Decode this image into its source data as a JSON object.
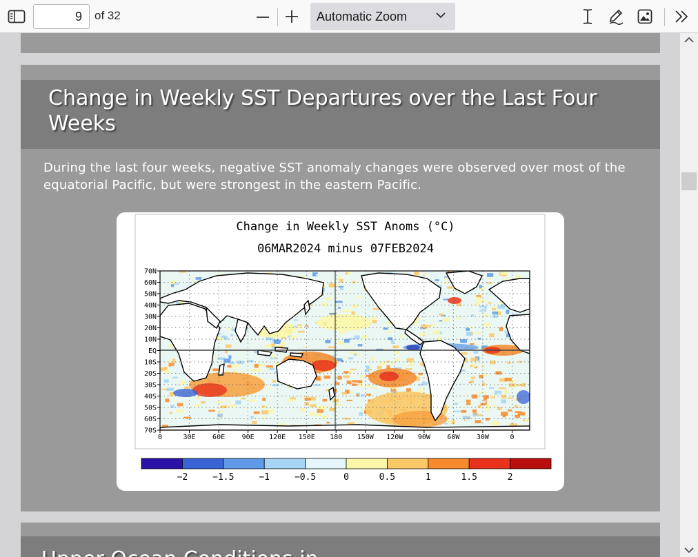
{
  "toolbar": {
    "page_number": "9",
    "page_count": "of 32",
    "zoom_value": "Automatic Zoom",
    "icons": {
      "sidebar": "sidebar-toggle-icon",
      "zoom_out": "minus-icon",
      "zoom_in": "plus-icon",
      "dropdown": "chevron-down-icon",
      "text": "text-cursor-icon",
      "draw": "pencil-icon",
      "image": "image-icon",
      "more": "double-chevron-right-icon"
    }
  },
  "slide": {
    "title": "Change in Weekly SST Departures over the Last Four Weeks",
    "description": "During the last four weeks, negative SST anomaly changes were observed over most of the equatorial Pacific, but were strongest in the eastern Pacific.",
    "next_title": "Upper Ocean Conditions in"
  },
  "figure": {
    "title": "Change in Weekly SST Anoms (°C)",
    "subtitle": "06MAR2024 minus 07FEB2024",
    "lat_labels": [
      "70N",
      "60N",
      "50N",
      "40N",
      "30N",
      "20N",
      "10N",
      "EQ",
      "10S",
      "20S",
      "30S",
      "40S",
      "50S",
      "60S",
      "70S"
    ],
    "lon_labels": [
      "0",
      "30E",
      "60E",
      "90E",
      "120E",
      "150E",
      "180",
      "150W",
      "120W",
      "90W",
      "60W",
      "30W",
      "0"
    ],
    "colorbar_labels": [
      "−2",
      "−1.5",
      "−1",
      "−0.5",
      "0",
      "0.5",
      "1",
      "1.5",
      "2"
    ],
    "colorbar_colors": [
      "#2a12a8",
      "#3a64d6",
      "#5e9ae8",
      "#a6d4f5",
      "#e4f6fb",
      "#fbf6a8",
      "#fbc867",
      "#f78a2c",
      "#e8321c",
      "#b80e0e"
    ]
  },
  "colors": {
    "toolbar_bg": "#f9f9fa",
    "viewer_bg": "#d4d4d7",
    "page_bg": "#9a9a9a",
    "title_band": "#7d7d7d"
  }
}
